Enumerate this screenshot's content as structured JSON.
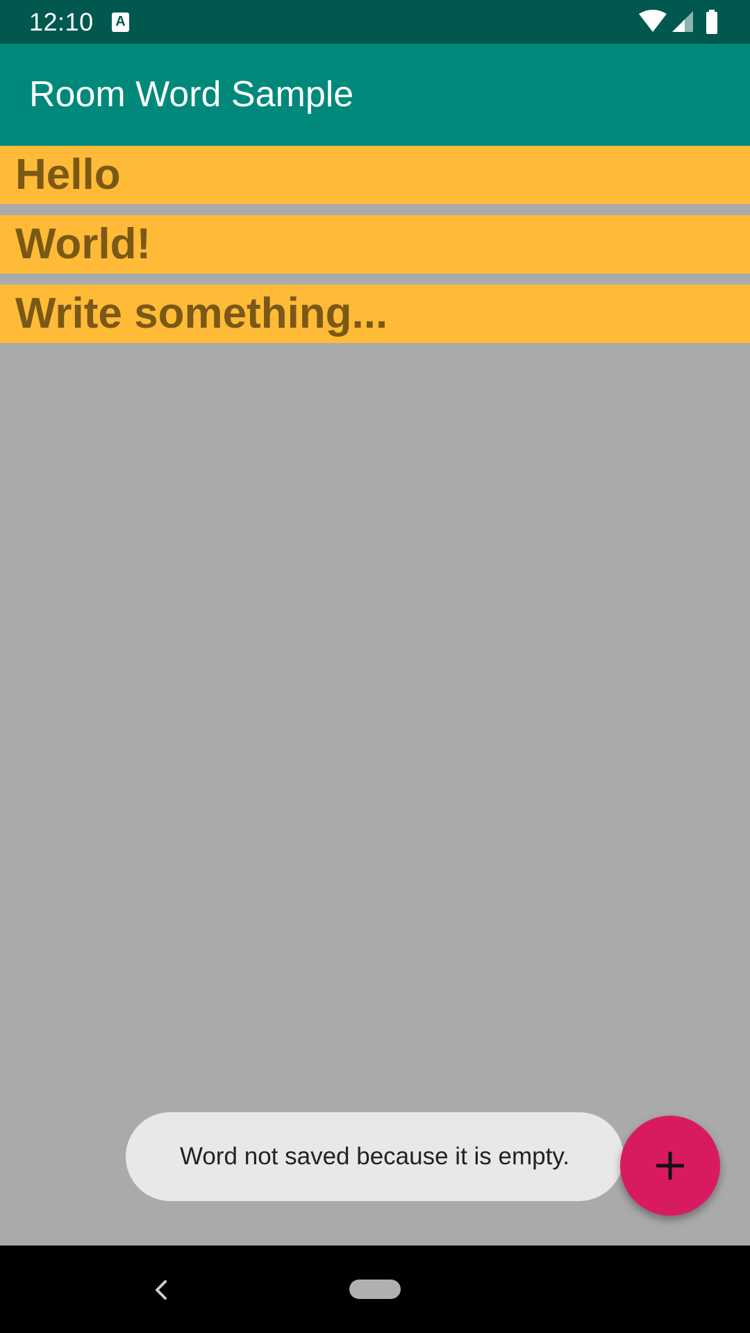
{
  "status_bar": {
    "time": "12:10",
    "icons": [
      "a-notification-icon",
      "wifi-icon",
      "cell-signal-icon",
      "battery-icon"
    ]
  },
  "app_bar": {
    "title": "Room Word Sample"
  },
  "words": [
    "Hello",
    "World!",
    "Write something..."
  ],
  "toast": {
    "message": "Word not saved because it is empty."
  },
  "fab": {
    "icon": "plus-icon"
  },
  "nav": {
    "icons": [
      "back-icon",
      "home-pill-icon"
    ]
  },
  "colors": {
    "status_bar": "#00584f",
    "app_bar": "#00897b",
    "background": "#aaaaaa",
    "word_item": "#ffbb37",
    "word_text": "#7a5816",
    "fab": "#d81b60",
    "toast": "#e8e8e8"
  }
}
